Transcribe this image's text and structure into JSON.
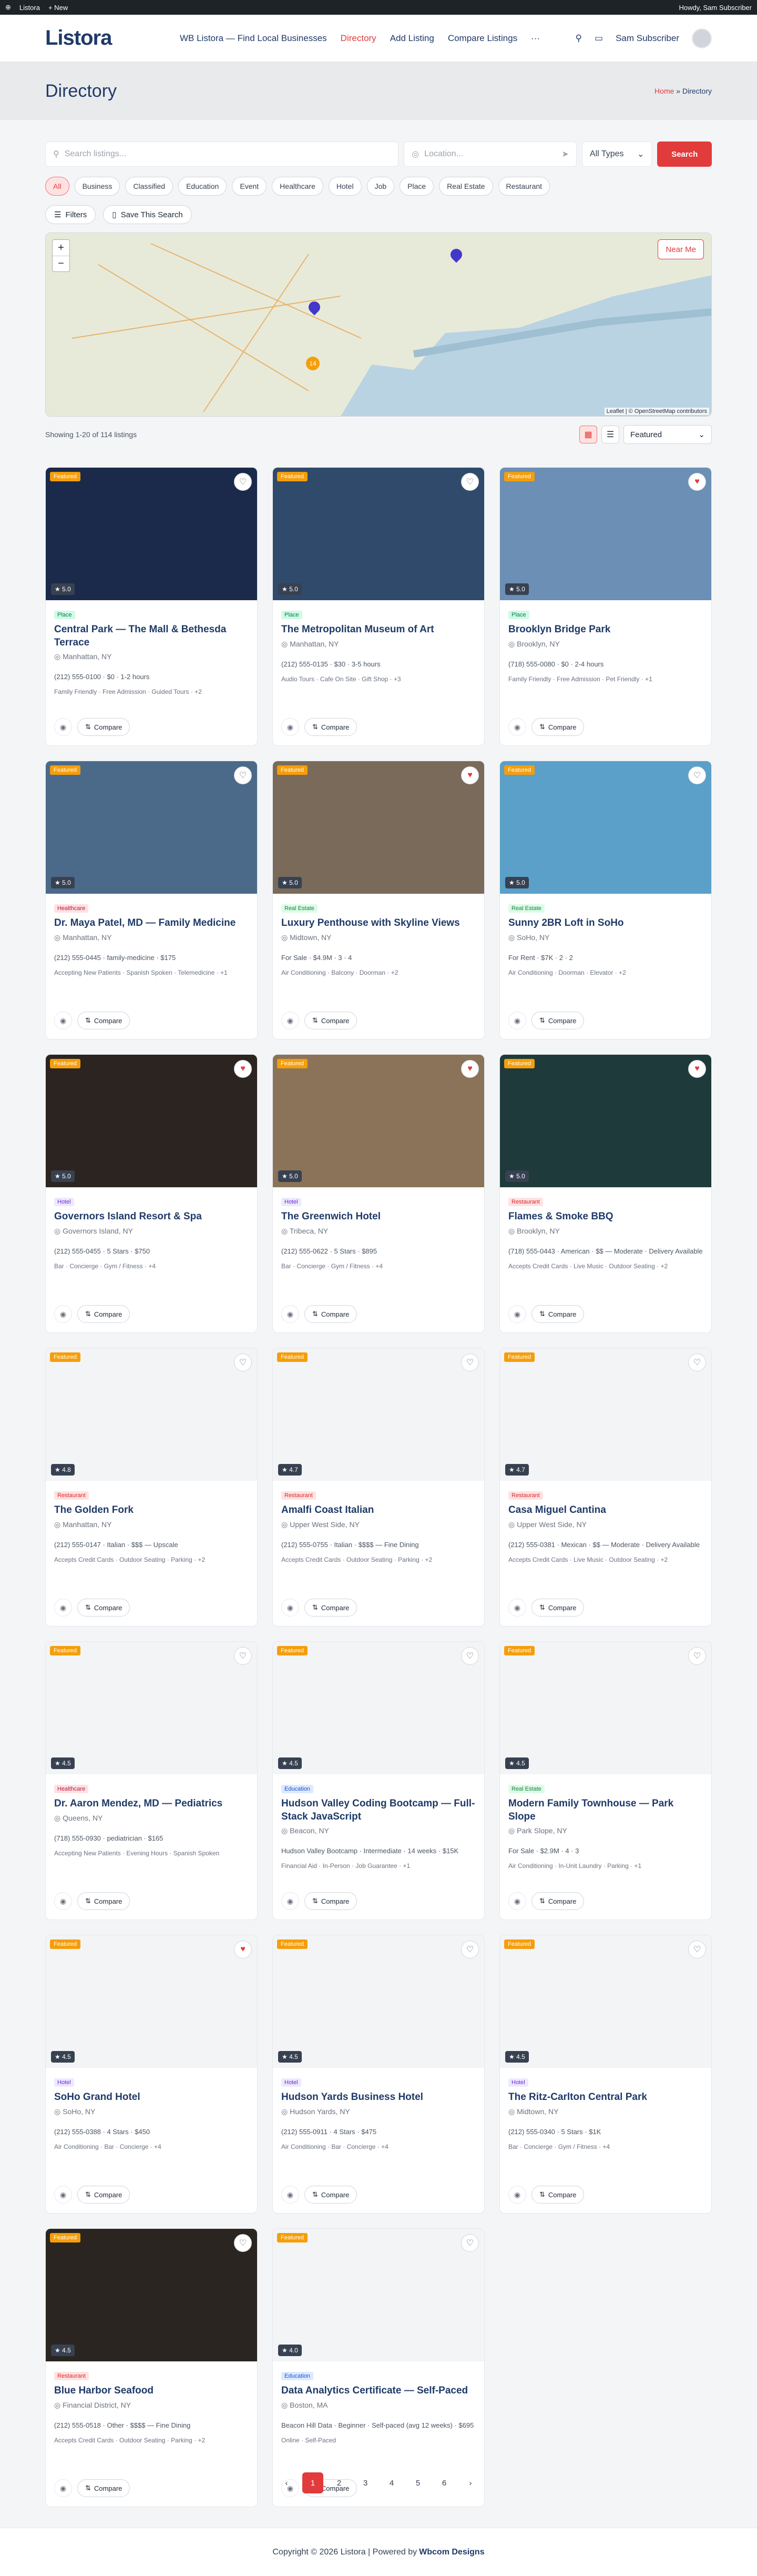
{
  "adminbar": {
    "site": "Listora",
    "new": "+ New",
    "greeting": "Howdy, Sam Subscriber"
  },
  "header": {
    "logo": "Listora",
    "nav": [
      "WB Listora — Find Local Businesses",
      "Directory",
      "Add Listing",
      "Compare Listings"
    ],
    "more": "···",
    "user": "Sam Subscriber"
  },
  "banner": {
    "title": "Directory",
    "home": "Home",
    "current": "Directory"
  },
  "search": {
    "keyword_placeholder": "Search listings...",
    "location_placeholder": "Location...",
    "type": "All Types",
    "button": "Search"
  },
  "categories": [
    "All",
    "Business",
    "Classified",
    "Education",
    "Event",
    "Healthcare",
    "Hotel",
    "Job",
    "Place",
    "Real Estate",
    "Restaurant"
  ],
  "filters": {
    "filters": "Filters",
    "save": "Save This Search"
  },
  "map": {
    "near_me": "Near Me",
    "attribution": "Leaflet | © OpenStreetMap contributors",
    "cluster": "14"
  },
  "results": {
    "count": "Showing 1-20 of 114 listings",
    "sort": "Featured"
  },
  "listings": [
    {
      "title": "Central Park — The Mall & Bethesda Terrace",
      "type": "Place",
      "tclass": "t-place",
      "loc": "Manhattan, NY",
      "meta": "(212) 555-0100 · $0 · 1-2 hours",
      "tags": "Family Friendly · Free Admission · Guided Tours · +2",
      "rating": "5.0",
      "featured": true,
      "fav": false,
      "img": "#1b2a4a"
    },
    {
      "title": "The Metropolitan Museum of Art",
      "type": "Place",
      "tclass": "t-place",
      "loc": "Manhattan, NY",
      "meta": "(212) 555-0135 · $30 · 3-5 hours",
      "tags": "Audio Tours · Cafe On Site · Gift Shop · +3",
      "rating": "5.0",
      "featured": true,
      "fav": false,
      "img": "#2f4a6b"
    },
    {
      "title": "Brooklyn Bridge Park",
      "type": "Place",
      "tclass": "t-place",
      "loc": "Brooklyn, NY",
      "meta": "(718) 555-0080 · $0 · 2-4 hours",
      "tags": "Family Friendly · Free Admission · Pet Friendly · +1",
      "rating": "5.0",
      "featured": true,
      "fav": true,
      "img": "#6b8fb5"
    },
    {
      "title": "Dr. Maya Patel, MD — Family Medicine",
      "type": "Healthcare",
      "tclass": "t-health",
      "loc": "Manhattan, NY",
      "meta": "(212) 555-0445 · family-medicine · $175",
      "tags": "Accepting New Patients · Spanish Spoken · Telemedicine · +1",
      "rating": "5.0",
      "featured": true,
      "fav": false,
      "img": "#4b6a8a"
    },
    {
      "title": "Luxury Penthouse with Skyline Views",
      "type": "Real Estate",
      "tclass": "t-re",
      "loc": "Midtown, NY",
      "meta": "For Sale · $4.9M · 3 · 4",
      "tags": "Air Conditioning · Balcony · Doorman · +2",
      "rating": "5.0",
      "featured": true,
      "fav": true,
      "img": "#7a6a5a"
    },
    {
      "title": "Sunny 2BR Loft in SoHo",
      "type": "Real Estate",
      "tclass": "t-re",
      "loc": "SoHo, NY",
      "meta": "For Rent · $7K · 2 · 2",
      "tags": "Air Conditioning · Doorman · Elevator · +2",
      "rating": "5.0",
      "featured": true,
      "fav": false,
      "img": "#5aa0c8"
    },
    {
      "title": "Governors Island Resort & Spa",
      "type": "Hotel",
      "tclass": "t-hotel",
      "loc": "Governors Island, NY",
      "meta": "(212) 555-0455 · 5 Stars · $750",
      "tags": "Bar · Concierge · Gym / Fitness · +4",
      "rating": "5.0",
      "featured": true,
      "fav": true,
      "img": "#2b2420"
    },
    {
      "title": "The Greenwich Hotel",
      "type": "Hotel",
      "tclass": "t-hotel",
      "loc": "Tribeca, NY",
      "meta": "(212) 555-0622 · 5 Stars · $895",
      "tags": "Bar · Concierge · Gym / Fitness · +4",
      "rating": "5.0",
      "featured": true,
      "fav": true,
      "img": "#8a7358"
    },
    {
      "title": "Flames & Smoke BBQ",
      "type": "Restaurant",
      "tclass": "t-rest",
      "loc": "Brooklyn, NY",
      "meta": "(718) 555-0443 · American · $$ — Moderate · Delivery Available",
      "tags": "Accepts Credit Cards · Live Music · Outdoor Seating · +2",
      "rating": "5.0",
      "featured": true,
      "fav": true,
      "img": "#1e3a3a"
    },
    {
      "title": "The Golden Fork",
      "type": "Restaurant",
      "tclass": "t-rest",
      "loc": "Manhattan, NY",
      "meta": "(212) 555-0147 · Italian · $$$ — Upscale",
      "tags": "Accepts Credit Cards · Outdoor Seating · Parking · +2",
      "rating": "4.8",
      "featured": true,
      "fav": false,
      "img": ""
    },
    {
      "title": "Amalfi Coast Italian",
      "type": "Restaurant",
      "tclass": "t-rest",
      "loc": "Upper West Side, NY",
      "meta": "(212) 555-0755 · Italian · $$$$ — Fine Dining",
      "tags": "Accepts Credit Cards · Outdoor Seating · Parking · +2",
      "rating": "4.7",
      "featured": true,
      "fav": false,
      "img": ""
    },
    {
      "title": "Casa Miguel Cantina",
      "type": "Restaurant",
      "tclass": "t-rest",
      "loc": "Upper West Side, NY",
      "meta": "(212) 555-0381 · Mexican · $$ — Moderate · Delivery Available",
      "tags": "Accepts Credit Cards · Live Music · Outdoor Seating · +2",
      "rating": "4.7",
      "featured": true,
      "fav": false,
      "img": ""
    },
    {
      "title": "Dr. Aaron Mendez, MD — Pediatrics",
      "type": "Healthcare",
      "tclass": "t-health",
      "loc": "Queens, NY",
      "meta": "(718) 555-0930 · pediatrician · $165",
      "tags": "Accepting New Patients · Evening Hours · Spanish Spoken",
      "rating": "4.5",
      "featured": true,
      "fav": false,
      "img": ""
    },
    {
      "title": "Hudson Valley Coding Bootcamp — Full-Stack JavaScript",
      "type": "Education",
      "tclass": "t-edu",
      "loc": "Beacon, NY",
      "meta": "Hudson Valley Bootcamp · Intermediate · 14 weeks · $15K",
      "tags": "Financial Aid · In-Person · Job Guarantee · +1",
      "rating": "4.5",
      "featured": true,
      "fav": false,
      "img": ""
    },
    {
      "title": "Modern Family Townhouse — Park Slope",
      "type": "Real Estate",
      "tclass": "t-re",
      "loc": "Park Slope, NY",
      "meta": "For Sale · $2.9M · 4 · 3",
      "tags": "Air Conditioning · In-Unit Laundry · Parking · +1",
      "rating": "4.5",
      "featured": true,
      "fav": false,
      "img": ""
    },
    {
      "title": "SoHo Grand Hotel",
      "type": "Hotel",
      "tclass": "t-hotel",
      "loc": "SoHo, NY",
      "meta": "(212) 555-0388 · 4 Stars · $450",
      "tags": "Air Conditioning · Bar · Concierge · +4",
      "rating": "4.5",
      "featured": true,
      "fav": true,
      "img": ""
    },
    {
      "title": "Hudson Yards Business Hotel",
      "type": "Hotel",
      "tclass": "t-hotel",
      "loc": "Hudson Yards, NY",
      "meta": "(212) 555-0911 · 4 Stars · $475",
      "tags": "Air Conditioning · Bar · Concierge · +4",
      "rating": "4.5",
      "featured": true,
      "fav": false,
      "img": ""
    },
    {
      "title": "The Ritz-Carlton Central Park",
      "type": "Hotel",
      "tclass": "t-hotel",
      "loc": "Midtown, NY",
      "meta": "(212) 555-0340 · 5 Stars · $1K",
      "tags": "Bar · Concierge · Gym / Fitness · +4",
      "rating": "4.5",
      "featured": true,
      "fav": false,
      "img": ""
    },
    {
      "title": "Blue Harbor Seafood",
      "type": "Restaurant",
      "tclass": "t-rest",
      "loc": "Financial District, NY",
      "meta": "(212) 555-0518 · Other · $$$$ — Fine Dining",
      "tags": "Accepts Credit Cards · Outdoor Seating · Parking · +2",
      "rating": "4.5",
      "featured": true,
      "fav": false,
      "img": "#2a2520"
    },
    {
      "title": "Data Analytics Certificate — Self-Paced",
      "type": "Education",
      "tclass": "t-edu",
      "loc": "Boston, MA",
      "meta": "Beacon Hill Data · Beginner · Self-paced (avg 12 weeks) · $695",
      "tags": "Online · Self-Paced",
      "rating": "4.0",
      "featured": true,
      "fav": false,
      "img": ""
    }
  ],
  "ui": {
    "featured": "Featured",
    "compare": "Compare"
  },
  "pagination": [
    "‹",
    "1",
    "2",
    "3",
    "4",
    "5",
    "6",
    "›"
  ],
  "footer": {
    "text": "Copyright © 2026 Listora | Powered by",
    "brand": "Wbcom Designs"
  }
}
